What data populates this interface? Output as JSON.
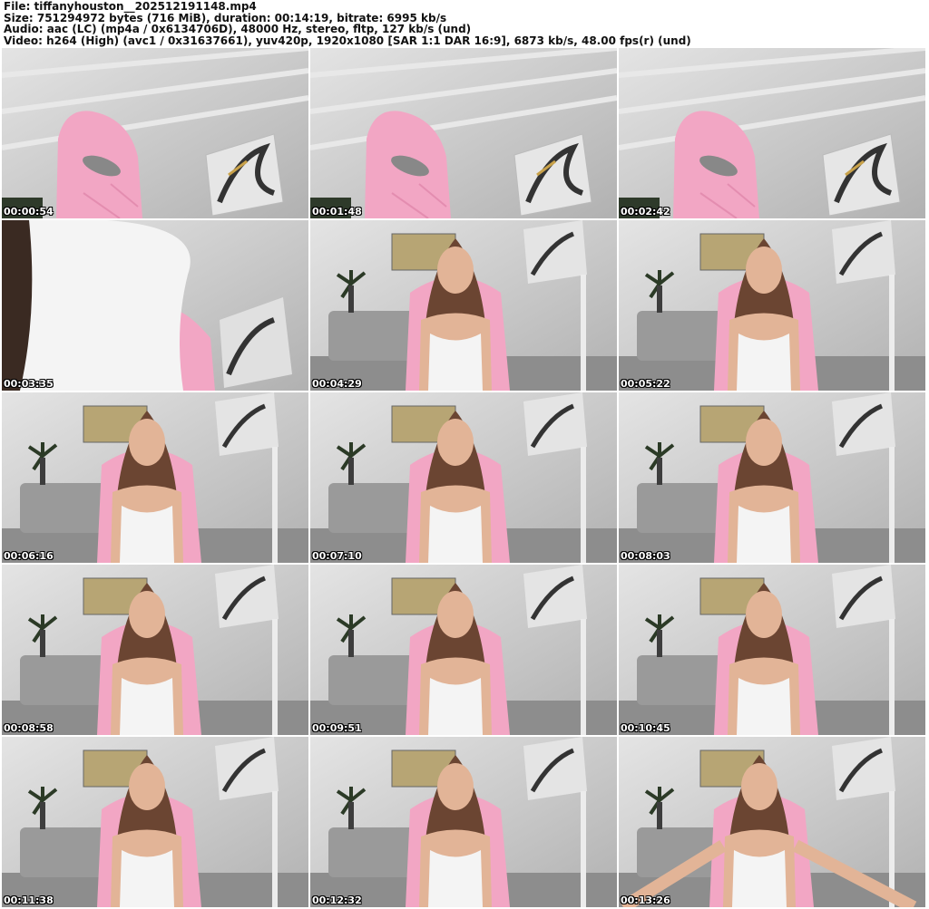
{
  "header": {
    "line1": "File: tiffanyhouston__202512191148.mp4",
    "line2": "Size: 751294972 bytes (716 MiB), duration: 00:14:19, bitrate: 6995 kb/s",
    "line3": "Audio: aac (LC) (mp4a / 0x6134706D), 48000 Hz, stereo, fltp, 127 kb/s (und)",
    "line4": "Video: h264 (High) (avc1 / 0x31637661), yuv420p, 1920x1080 [SAR 1:1 DAR 16:9], 6873 kb/s, 48.00 fps(r) (und)"
  },
  "thumbnails": [
    {
      "time": "00:00:54",
      "scene": "empty-chair"
    },
    {
      "time": "00:01:48",
      "scene": "empty-chair"
    },
    {
      "time": "00:02:42",
      "scene": "empty-chair"
    },
    {
      "time": "00:03:35",
      "scene": "closeup-blur"
    },
    {
      "time": "00:04:29",
      "scene": "seated"
    },
    {
      "time": "00:05:22",
      "scene": "seated"
    },
    {
      "time": "00:06:16",
      "scene": "seated"
    },
    {
      "time": "00:07:10",
      "scene": "seated"
    },
    {
      "time": "00:08:03",
      "scene": "seated"
    },
    {
      "time": "00:08:58",
      "scene": "seated"
    },
    {
      "time": "00:09:51",
      "scene": "seated"
    },
    {
      "time": "00:10:45",
      "scene": "seated"
    },
    {
      "time": "00:11:38",
      "scene": "seated"
    },
    {
      "time": "00:12:32",
      "scene": "seated"
    },
    {
      "time": "00:13:26",
      "scene": "seated-wide"
    }
  ],
  "colors": {
    "wall": "#c9c9c9",
    "chair": "#f2a6c4",
    "sofa": "#9a9a9a",
    "top": "#f4f4f4",
    "hair": "#6b4532",
    "skin": "#e2b497"
  }
}
